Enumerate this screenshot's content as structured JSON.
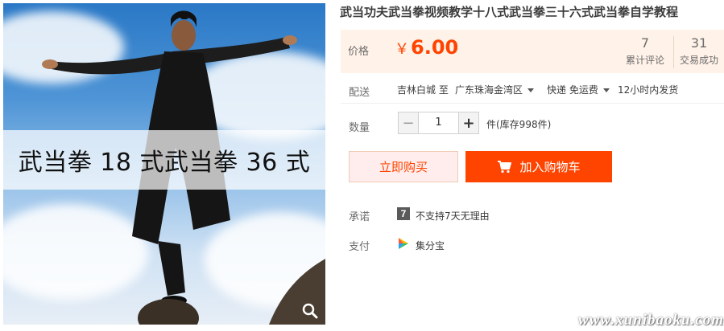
{
  "image": {
    "caption": "武当拳 18 式武当拳 36 式",
    "zoom_icon": "magnifier-icon"
  },
  "title": "武当功夫武当拳视频教学十八式武当拳三十六式武当拳自学教程",
  "price": {
    "label": "价格",
    "currency": "￥",
    "value": "6.00",
    "color": "#ff4400"
  },
  "stats": [
    {
      "num": "7",
      "label": "累计评论"
    },
    {
      "num": "31",
      "label": "交易成功"
    }
  ],
  "shipping": {
    "label": "配送",
    "from": "吉林白城 至",
    "to": "广东珠海金湾区",
    "method": "快递 免运费",
    "time": "12小时内发货"
  },
  "quantity": {
    "label": "数量",
    "minus": "−",
    "value": "1",
    "plus": "+",
    "stock": "件(库存998件)"
  },
  "actions": {
    "buy_now": "立即购买",
    "add_to_cart": "加入购物车",
    "cart_icon": "shopping-cart-icon"
  },
  "promise": {
    "label": "承诺",
    "icon_text": "7",
    "text": "不支持7天无理由"
  },
  "payment": {
    "label": "支付",
    "icon": "jifenbao-icon",
    "text": "集分宝"
  },
  "watermark": "www.xunibaoku.com"
}
